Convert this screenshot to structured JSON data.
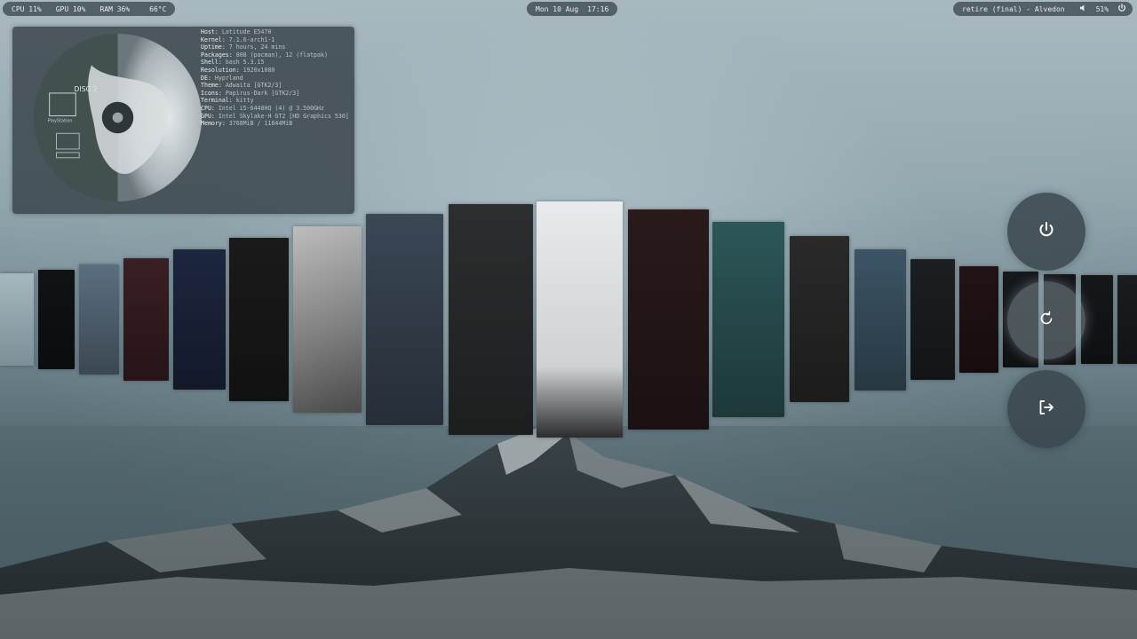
{
  "topbar": {
    "cpu": "CPU 11%",
    "gpu": "GPU 10%",
    "ram": "RAM 36%",
    "temp": "66°C",
    "date": "Mon 10 Aug",
    "time": "17:16",
    "media": "retire (final) - Alvedon",
    "volume": "51%",
    "icons": {
      "volume": "speaker-icon",
      "power": "power-icon"
    }
  },
  "fetch": {
    "art_text": {
      "disc": "DISC 2",
      "brand": "PlayStation"
    },
    "lines": [
      {
        "key": "Host:",
        "value": "Latitude E5470"
      },
      {
        "key": "Kernel:",
        "value": "7.1.6-arch1-1"
      },
      {
        "key": "Uptime:",
        "value": "7 hours, 24 mins"
      },
      {
        "key": "Packages:",
        "value": "808 (pacman), 12 (flatpak)"
      },
      {
        "key": "Shell:",
        "value": "bash 5.3.15"
      },
      {
        "key": "Resolution:",
        "value": "1920x1080"
      },
      {
        "key": "DE:",
        "value": "Hyprland"
      },
      {
        "key": "Theme:",
        "value": "Adwaita [GTK2/3]"
      },
      {
        "key": "Icons:",
        "value": "Papirus-Dark [GTK2/3]"
      },
      {
        "key": "Terminal:",
        "value": "kitty"
      },
      {
        "key": "CPU:",
        "value": "Intel i5-6440HQ (4) @ 3.500GHz"
      },
      {
        "key": "GPU:",
        "value": "Intel Skylake-H GT2 [HD Graphics 530]"
      },
      {
        "key": "Memory:",
        "value": "3768MiB / 11844MiB"
      }
    ]
  },
  "wallpapers": [
    {
      "name": "wallpaper-fog",
      "color": "#8fa3ab"
    },
    {
      "name": "wallpaper-dark-splash",
      "color": "#101214"
    },
    {
      "name": "wallpaper-city-blue",
      "color": "#5b6e80"
    },
    {
      "name": "wallpaper-red-figure",
      "color": "#3a1f24"
    },
    {
      "name": "wallpaper-skyscraper-night",
      "color": "#1d2640"
    },
    {
      "name": "wallpaper-white-figure",
      "color": "#1a1a1a"
    },
    {
      "name": "wallpaper-grey-mountain",
      "color": "#8d8d8d"
    },
    {
      "name": "wallpaper-city-diagonal",
      "color": "#3a4755"
    },
    {
      "name": "wallpaper-window-silhouette",
      "color": "#2c2e2f"
    },
    {
      "name": "wallpaper-snow-tree",
      "color": "#d4d6d7"
    },
    {
      "name": "wallpaper-dark-red",
      "color": "#2a1a1b"
    },
    {
      "name": "wallpaper-teal-forest",
      "color": "#2d5658"
    },
    {
      "name": "wallpaper-dress-figure",
      "color": "#2a2a2a"
    },
    {
      "name": "wallpaper-neon-street",
      "color": "#3c5566"
    },
    {
      "name": "wallpaper-anime-portrait",
      "color": "#1c1f22"
    },
    {
      "name": "wallpaper-red-hair",
      "color": "#221316"
    },
    {
      "name": "wallpaper-terminal",
      "color": "#16191c"
    },
    {
      "name": "wallpaper-dark-panel",
      "color": "#121417"
    },
    {
      "name": "wallpaper-skull-figure",
      "color": "#151719"
    },
    {
      "name": "wallpaper-edge",
      "color": "#1a1d20"
    }
  ],
  "power_menu": [
    {
      "name": "shutdown-button",
      "icon": "power-icon"
    },
    {
      "name": "reboot-button",
      "icon": "refresh-icon"
    },
    {
      "name": "logout-button",
      "icon": "logout-icon"
    }
  ]
}
